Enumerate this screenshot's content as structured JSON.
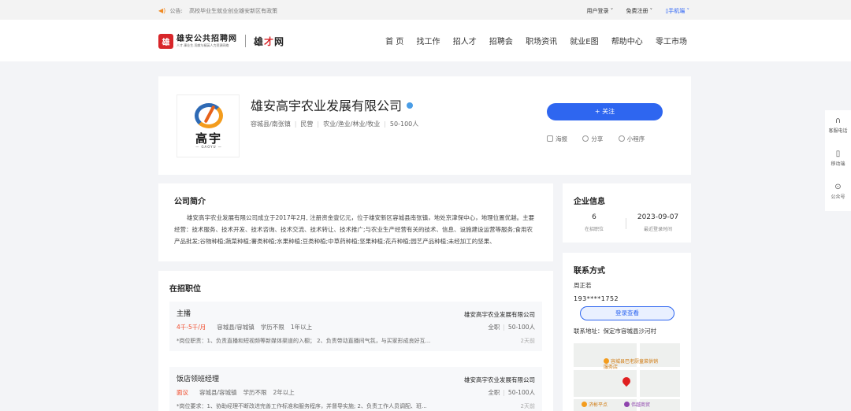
{
  "topbar": {
    "notice_label": "公告:",
    "notice_text": "高校毕业生就业创业雄安新区有政策",
    "links": [
      "用户登录 ˅",
      "免费注册 ˅",
      "▯手机端 ˅"
    ]
  },
  "header": {
    "logo_cn": "雄安公共招聘网",
    "logo_sub": "人才.事业生.贡献与精英人力资源网络",
    "brand2_a": "雄",
    "brand2_b": "才",
    "brand2_c": "网",
    "nav": [
      "首 页",
      "找工作",
      "招人才",
      "招聘会",
      "职场资讯",
      "就业E图",
      "帮助中心",
      "零工市场"
    ]
  },
  "company": {
    "name": "雄安高宇农业发展有限公司",
    "logo_cn": "高宇",
    "logo_en": "— GAOYU —",
    "tags": [
      "容城县/南张镇",
      "民营",
      "农业/渔业/林业/牧业",
      "50-100人"
    ],
    "follow_label": "+ 关注",
    "share": [
      "海报",
      "分享",
      "小程序"
    ]
  },
  "intro": {
    "title": "公司简介",
    "text": "雄安高宇农业发展有限公司成立于2017年2月, 注册资金壹亿元，位于雄安新区容城县南张镇，地处京津保中心，地理位置优越。主要经营：技术服务、技术开发、技术咨询、技术交流、技术转让、技术推广;与农业生产经营有关的技术、信息、设施建设运营等服务;食用农产品批发;谷物种植;蔬菜种植;薯类种植;水果种植;豆类种植;中草药种植;坚果种植;花卉种植;园艺产品种植;未经加工的坚果、"
  },
  "jobs": {
    "title": "在招职位",
    "items": [
      {
        "title": "主播",
        "company": "雄安高宇农业发展有限公司",
        "salary": "4千-5千/月",
        "location": "容城县/容城镇",
        "education": "学历不限",
        "experience": "1年以上",
        "type": "全职",
        "size": "50-100人",
        "desc": "*岗位职责：1、负责直播和短视频等新媒体渠道的入橱； 2、负责带动直播间气氛，与买家形成良好互...",
        "time": "2天前"
      },
      {
        "title": "饭店领班经理",
        "company": "雄安高宇农业发展有限公司",
        "salary": "面议",
        "location": "容城县/容城镇",
        "education": "学历不限",
        "experience": "2年以上",
        "type": "全职",
        "size": "50-100人",
        "desc": "*岗位要求：1、协助经理不断改进完善工作标准和服务程序，并督导实施; 2、负责工作人员调配、班...",
        "time": "2天前"
      }
    ]
  },
  "entinfo": {
    "title": "企业信息",
    "jobs_count": "6",
    "jobs_label": "在招职位",
    "date": "2023-09-07",
    "date_label": "最近登录时间"
  },
  "contact": {
    "title": "联系方式",
    "person": "周正若",
    "phone": "193****1752",
    "login_label": "登录查看",
    "address": "联系地址：保定市容城县沙河村",
    "map_poi1": "容城县巴老厨童菜供销服务店",
    "map_poi2": "济彬平点",
    "map_poi3": "伟越商贸"
  },
  "float": {
    "items": [
      {
        "icon": "∩",
        "label": "客服电话"
      },
      {
        "icon": "▯",
        "label": "移动端"
      },
      {
        "icon": "⊙",
        "label": "公众号"
      }
    ]
  },
  "colors": {
    "accent": "#2e66f0",
    "salary": "#f04a2a",
    "brand_red": "#d8262a"
  }
}
